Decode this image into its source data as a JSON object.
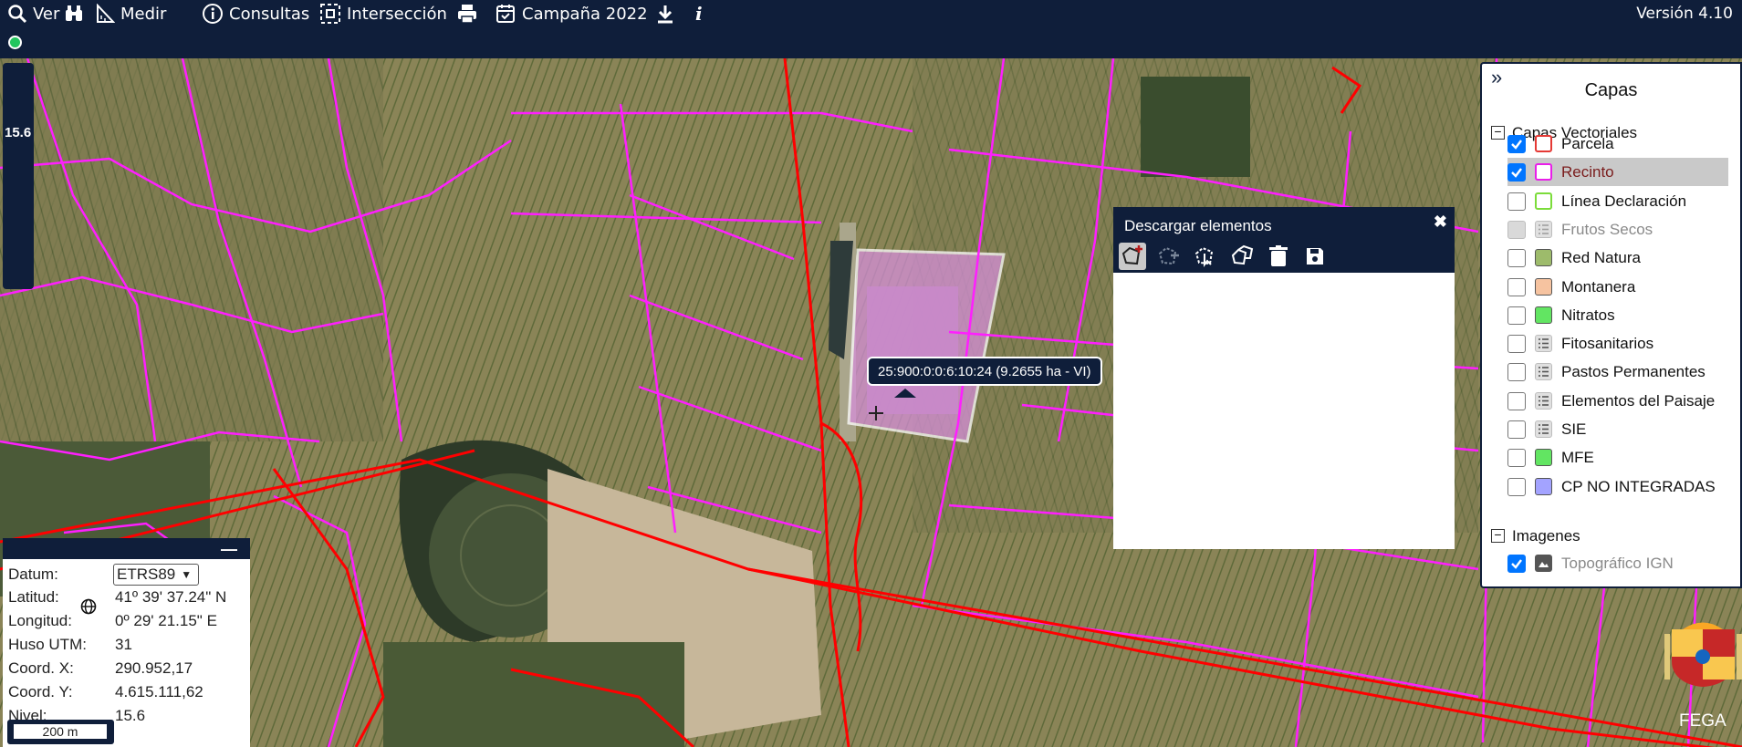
{
  "toolbar": {
    "items": [
      {
        "label": "Ver",
        "icon": "magnifier-icon"
      },
      {
        "label": "",
        "icon": "binoculars-icon"
      },
      {
        "label": "Medir",
        "icon": "ruler-icon"
      },
      {
        "label": "Consultas",
        "icon": "info-circle-icon"
      },
      {
        "label": "Intersección",
        "icon": "dashed-square-icon"
      },
      {
        "label": "",
        "icon": "printer-icon"
      },
      {
        "label": "Campaña 2022",
        "icon": "calendar-check-icon"
      },
      {
        "label": "",
        "icon": "download-icon"
      },
      {
        "label": "",
        "icon": "italic-info-icon"
      }
    ],
    "version": "Versión 4.10"
  },
  "zoom": {
    "level": "15.6"
  },
  "layers": {
    "title": "Capas",
    "groups": [
      {
        "label": "Capas Vectoriales",
        "expanded": true
      },
      {
        "label": "Imagenes",
        "expanded": true
      }
    ],
    "items": [
      {
        "label": "Parcela",
        "checked": true,
        "enabled": true,
        "swatch": "#e53935",
        "swatch_type": "outline",
        "selected": false
      },
      {
        "label": "Recinto",
        "checked": true,
        "enabled": true,
        "swatch": "#e91ee9",
        "swatch_type": "outline",
        "selected": true
      },
      {
        "label": "Línea Declaración",
        "checked": false,
        "enabled": true,
        "swatch": "#7bdc3a",
        "swatch_type": "outline",
        "selected": false
      },
      {
        "label": "Frutos Secos",
        "checked": false,
        "enabled": false,
        "swatch": "#9e9e9e",
        "swatch_type": "list",
        "selected": false
      },
      {
        "label": "Red Natura",
        "checked": false,
        "enabled": true,
        "swatch": "#9dbb6b",
        "swatch_type": "fill",
        "selected": false
      },
      {
        "label": "Montanera",
        "checked": false,
        "enabled": true,
        "swatch": "#f6c3a0",
        "swatch_type": "fill",
        "selected": false
      },
      {
        "label": "Nitratos",
        "checked": false,
        "enabled": true,
        "swatch": "#62e562",
        "swatch_type": "fill",
        "selected": false
      },
      {
        "label": "Fitosanitarios",
        "checked": false,
        "enabled": true,
        "swatch": "#555555",
        "swatch_type": "list",
        "selected": false
      },
      {
        "label": "Pastos Permanentes",
        "checked": false,
        "enabled": true,
        "swatch": "#555555",
        "swatch_type": "list",
        "selected": false
      },
      {
        "label": "Elementos del Paisaje",
        "checked": false,
        "enabled": true,
        "swatch": "#555555",
        "swatch_type": "list",
        "selected": false
      },
      {
        "label": "SIE",
        "checked": false,
        "enabled": true,
        "swatch": "#555555",
        "swatch_type": "list",
        "selected": false
      },
      {
        "label": "MFE",
        "checked": false,
        "enabled": true,
        "swatch": "#62e562",
        "swatch_type": "fill",
        "selected": false
      },
      {
        "label": "CP NO INTEGRADAS",
        "checked": false,
        "enabled": true,
        "swatch": "#a3a3ff",
        "swatch_type": "fill",
        "selected": false
      },
      {
        "label": "Topográfico IGN",
        "checked": true,
        "enabled": false,
        "swatch": "#555555",
        "swatch_type": "image",
        "selected": false
      }
    ]
  },
  "download_panel": {
    "title": "Descargar elementos",
    "close": "✖",
    "tools": [
      "add-polygon-icon",
      "undo-polygon-icon",
      "select-polygon-icon",
      "copy-polygon-icon",
      "trash-icon",
      "save-icon"
    ]
  },
  "coords": {
    "datum_label": "Datum:",
    "datum_value": "ETRS89",
    "rows": [
      {
        "label": "Latitud:",
        "value": "41º 39' 37.24\" N"
      },
      {
        "label": "Longitud:",
        "value": "0º 29' 21.15\" E"
      },
      {
        "label": "Huso UTM:",
        "value": "31"
      },
      {
        "label": "Coord. X:",
        "value": "290.952,17"
      },
      {
        "label": "Coord. Y:",
        "value": "4.615.111,62"
      },
      {
        "label": "Nivel:",
        "value": "15.6"
      }
    ],
    "minimize": "—",
    "scale": "200 m"
  },
  "map": {
    "tooltip": "25:900:0:0:6:10:24 (9.2655 ha - VI)",
    "brand": "FEGA",
    "colors": {
      "recinto": "#ff1eff",
      "parcela": "#ff0000",
      "selected_fill": "#d58fd8"
    }
  }
}
